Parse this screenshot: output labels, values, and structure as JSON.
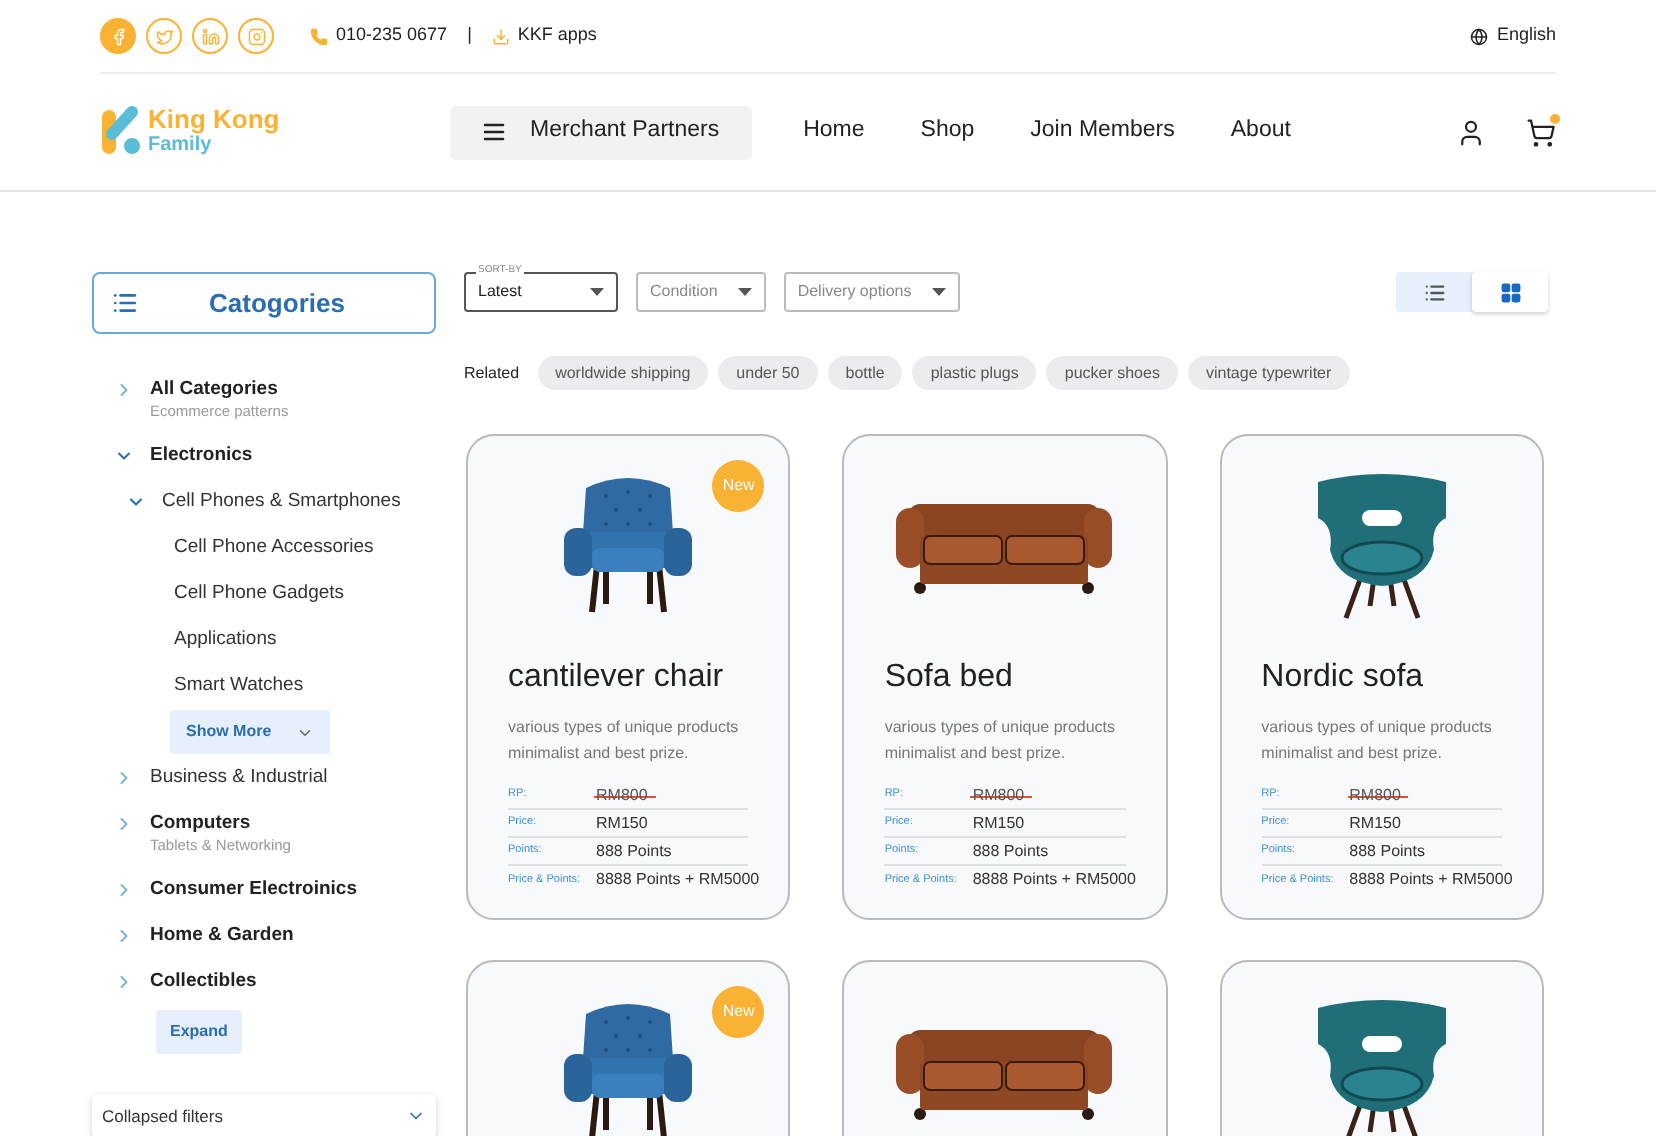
{
  "top_bar": {
    "socials": [
      {
        "kind": "facebook",
        "selected": true
      },
      {
        "kind": "twitter",
        "selected": false
      },
      {
        "kind": "linkedin",
        "selected": false
      },
      {
        "kind": "instagram",
        "selected": false
      }
    ],
    "phone": "010-235 0677",
    "separator": "|",
    "apps_link": "KKF apps",
    "language": "English"
  },
  "nav": {
    "logo": {
      "line_1": "King Kong",
      "line_2": "Family"
    },
    "menu_button": "Merchant Partners",
    "links": [
      "Home",
      "Shop",
      "Join Members",
      "About"
    ],
    "cart_has_items": true
  },
  "sidebar": {
    "title": "Catogories",
    "tree": [
      {
        "label": "All Categories",
        "subtitle": "Ecommerce patterns",
        "bold": true,
        "expanded": false
      },
      {
        "label": "Electronics",
        "bold": true,
        "expanded": true,
        "children": [
          {
            "label": "Cell Phones & Smartphones",
            "bold": false,
            "expanded": true,
            "children": [
              {
                "label": "Cell Phone Accessories",
                "bold": false
              },
              {
                "label": "Cell Phone Gadgets",
                "bold": false
              },
              {
                "label": "Applications",
                "bold": false
              },
              {
                "label": "Smart Watches",
                "bold": false
              }
            ],
            "show_more": "Show More"
          }
        ]
      },
      {
        "label": "Business & Industrial",
        "bold": false,
        "expanded": false
      },
      {
        "label": "Computers",
        "subtitle": "Tablets & Networking",
        "bold": true,
        "expanded": false
      },
      {
        "label": "Consumer Electroinics",
        "bold": true,
        "expanded": false
      },
      {
        "label": "Home & Garden",
        "bold": true,
        "expanded": false
      },
      {
        "label": "Collectibles",
        "bold": true,
        "expanded": false
      }
    ],
    "expand_button": "Expand",
    "collapsed_filters": "Collapsed filters"
  },
  "filters": [
    {
      "legend": "SORT-BY",
      "value": "Latest"
    },
    {
      "placeholder": "Condition"
    },
    {
      "placeholder": "Delivery options"
    }
  ],
  "view_toggle": [
    {
      "kind": "list",
      "selected": false
    },
    {
      "kind": "grid",
      "selected": true
    }
  ],
  "related": {
    "label": "Related",
    "tags": [
      "worldwide shipping",
      "under 50",
      "bottle",
      "plastic plugs",
      "pucker shoes",
      "vintage typewriter"
    ]
  },
  "products": [
    {
      "kind": "armchair",
      "badge": "New",
      "title": "cantilever chair",
      "description": "various types of unique products minimalist and best prize.",
      "details": [
        {
          "label": "RP:",
          "value": "RM800",
          "struck": true
        },
        {
          "label": "Price:",
          "value": "RM150",
          "struck": false
        },
        {
          "label": "Points:",
          "value": "888 Points",
          "struck": false
        },
        {
          "label": "Price & Points:",
          "value": "8888 Points + RM5000",
          "struck": false
        }
      ]
    },
    {
      "kind": "sofa",
      "title": "Sofa bed",
      "description": "various types of unique products minimalist and best prize.",
      "details": [
        {
          "label": "RP:",
          "value": "RM800",
          "struck": true
        },
        {
          "label": "Price:",
          "value": "RM150",
          "struck": false
        },
        {
          "label": "Points:",
          "value": "888 Points",
          "struck": false
        },
        {
          "label": "Price & Points:",
          "value": "8888 Points + RM5000",
          "struck": false
        }
      ]
    },
    {
      "kind": "lounge",
      "title": "Nordic sofa",
      "description": "various types of unique products minimalist and best prize.",
      "details": [
        {
          "label": "RP:",
          "value": "RM800",
          "struck": true
        },
        {
          "label": "Price:",
          "value": "RM150",
          "struck": false
        },
        {
          "label": "Points:",
          "value": "888 Points",
          "struck": false
        },
        {
          "label": "Price & Points:",
          "value": "8888 Points + RM5000",
          "struck": false
        }
      ]
    },
    {
      "kind": "armchair",
      "badge": "New"
    },
    {
      "kind": "sofa"
    },
    {
      "kind": "lounge"
    }
  ]
}
